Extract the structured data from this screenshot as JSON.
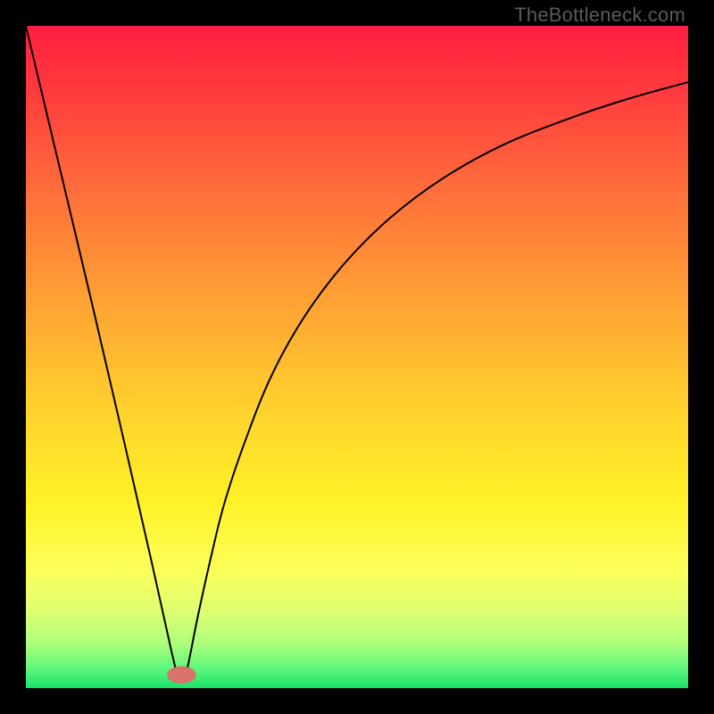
{
  "watermark": "TheBottleneck.com",
  "chart_data": {
    "type": "line",
    "title": "",
    "xlabel": "",
    "ylabel": "",
    "xlim": [
      0,
      100
    ],
    "ylim": [
      0,
      100
    ],
    "series": [
      {
        "name": "left-branch",
        "x": [
          0,
          5,
          10,
          15,
          19,
          21,
          22,
          22.7
        ],
        "y": [
          100,
          79,
          58,
          36.5,
          19,
          10,
          5.5,
          2.5
        ]
      },
      {
        "name": "right-branch",
        "x": [
          24.3,
          25,
          26,
          28,
          30,
          33,
          37,
          42,
          48,
          55,
          63,
          72,
          82,
          91,
          100
        ],
        "y": [
          2.5,
          6,
          11,
          20,
          28,
          37,
          47,
          56,
          64,
          71,
          77,
          82,
          86,
          89,
          91.5
        ]
      }
    ],
    "marker_pill": {
      "cx": 23.5,
      "cy": 2.0,
      "rx": 2.2,
      "ry": 1.3
    },
    "gradient_stops": [
      {
        "pct": 0.0,
        "color": "#ff1f3f"
      },
      {
        "pct": 0.1,
        "color": "#ff3b3e"
      },
      {
        "pct": 0.25,
        "color": "#ff6f3a"
      },
      {
        "pct": 0.42,
        "color": "#ffa334"
      },
      {
        "pct": 0.58,
        "color": "#ffd22d"
      },
      {
        "pct": 0.72,
        "color": "#fff227"
      },
      {
        "pct": 0.82,
        "color": "#fcff5a"
      },
      {
        "pct": 0.88,
        "color": "#e0ff70"
      },
      {
        "pct": 0.93,
        "color": "#b2ff7a"
      },
      {
        "pct": 0.97,
        "color": "#60f77c"
      },
      {
        "pct": 1.0,
        "color": "#19e36a"
      }
    ]
  }
}
